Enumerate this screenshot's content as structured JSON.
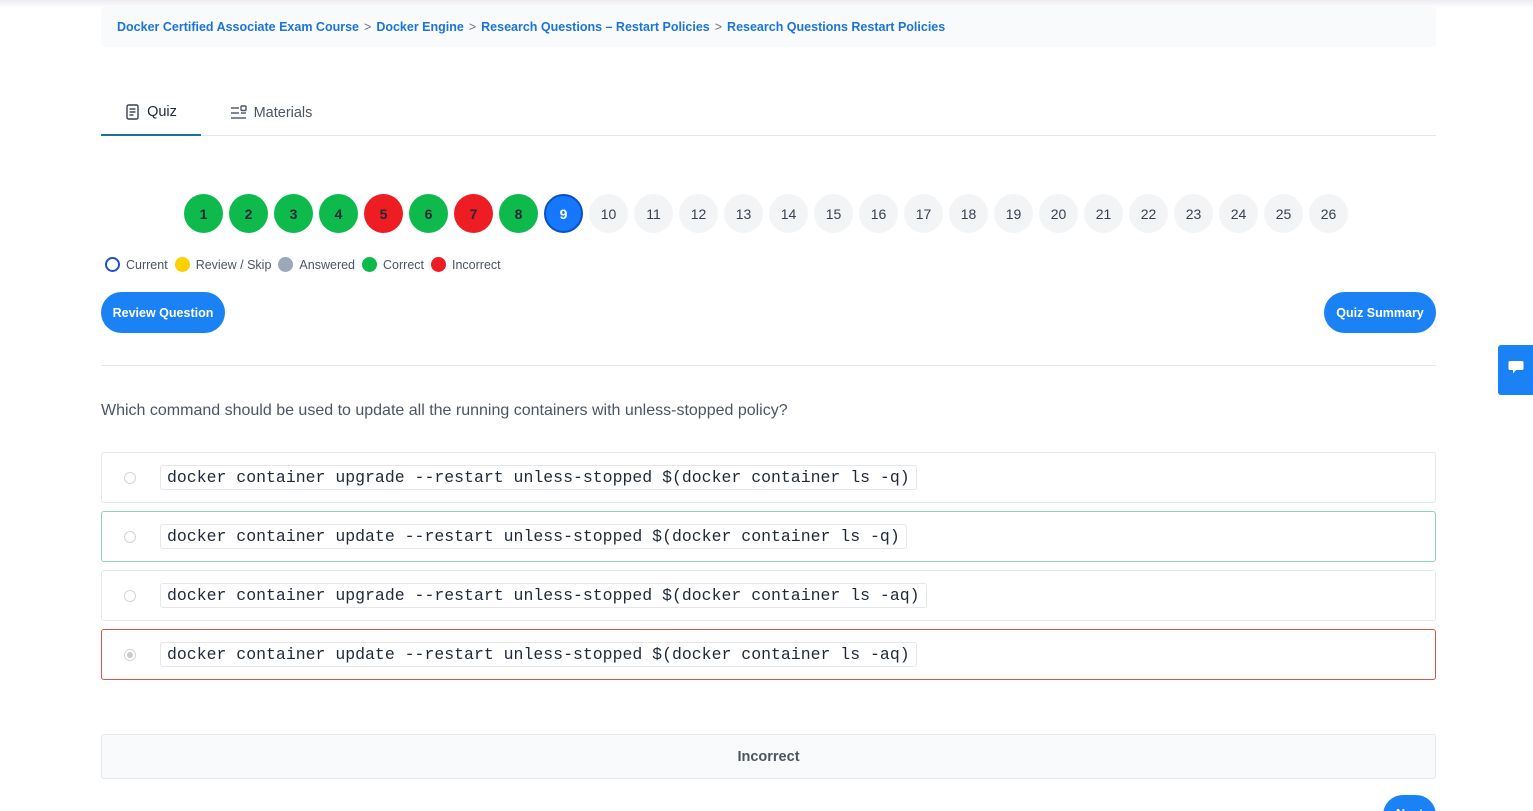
{
  "breadcrumb": {
    "items": [
      "Docker Certified Associate Exam Course",
      "Docker Engine",
      "Research Questions – Restart Policies",
      "Research Questions Restart Policies"
    ],
    "separator": ">"
  },
  "tabs": {
    "quiz": "Quiz",
    "materials": "Materials",
    "active": "Quiz"
  },
  "question_nav": [
    {
      "label": "1",
      "status": "correct"
    },
    {
      "label": "2",
      "status": "correct"
    },
    {
      "label": "3",
      "status": "correct"
    },
    {
      "label": "4",
      "status": "correct"
    },
    {
      "label": "5",
      "status": "incorrect"
    },
    {
      "label": "6",
      "status": "correct"
    },
    {
      "label": "7",
      "status": "incorrect"
    },
    {
      "label": "8",
      "status": "correct"
    },
    {
      "label": "9",
      "status": "current"
    },
    {
      "label": "10",
      "status": "pending"
    },
    {
      "label": "11",
      "status": "pending"
    },
    {
      "label": "12",
      "status": "pending"
    },
    {
      "label": "13",
      "status": "pending"
    },
    {
      "label": "14",
      "status": "pending"
    },
    {
      "label": "15",
      "status": "pending"
    },
    {
      "label": "16",
      "status": "pending"
    },
    {
      "label": "17",
      "status": "pending"
    },
    {
      "label": "18",
      "status": "pending"
    },
    {
      "label": "19",
      "status": "pending"
    },
    {
      "label": "20",
      "status": "pending"
    },
    {
      "label": "21",
      "status": "pending"
    },
    {
      "label": "22",
      "status": "pending"
    },
    {
      "label": "23",
      "status": "pending"
    },
    {
      "label": "24",
      "status": "pending"
    },
    {
      "label": "25",
      "status": "pending"
    },
    {
      "label": "26",
      "status": "pending"
    }
  ],
  "legend": {
    "current": "Current",
    "review": "Review / Skip",
    "answered": "Answered",
    "correct": "Correct",
    "incorrect": "Incorrect"
  },
  "buttons": {
    "review_question": "Review Question",
    "quiz_summary": "Quiz Summary",
    "next": "Next"
  },
  "question": {
    "text": "Which command should be used to update all the running containers with unless-stopped policy?",
    "options": [
      {
        "text": "docker container upgrade --restart unless-stopped $(docker container ls -q)",
        "state": "default",
        "selected": false
      },
      {
        "text": "docker container update --restart unless-stopped $(docker container ls -q)",
        "state": "correct",
        "selected": false
      },
      {
        "text": "docker container upgrade --restart unless-stopped $(docker container ls -aq)",
        "state": "default",
        "selected": false
      },
      {
        "text": "docker container update --restart unless-stopped $(docker container ls -aq)",
        "state": "incorrect",
        "selected": true
      }
    ]
  },
  "result": {
    "text": "Incorrect"
  },
  "colors": {
    "accent": "#1a82f5",
    "correct": "#0dba4b",
    "incorrect": "#ee1d23",
    "review": "#fbd100",
    "answered": "#9aa8ba"
  },
  "icons": {
    "quiz_tab": "quiz-document-icon",
    "materials_tab": "materials-list-icon",
    "feedback": "chat-bubble-icon"
  }
}
